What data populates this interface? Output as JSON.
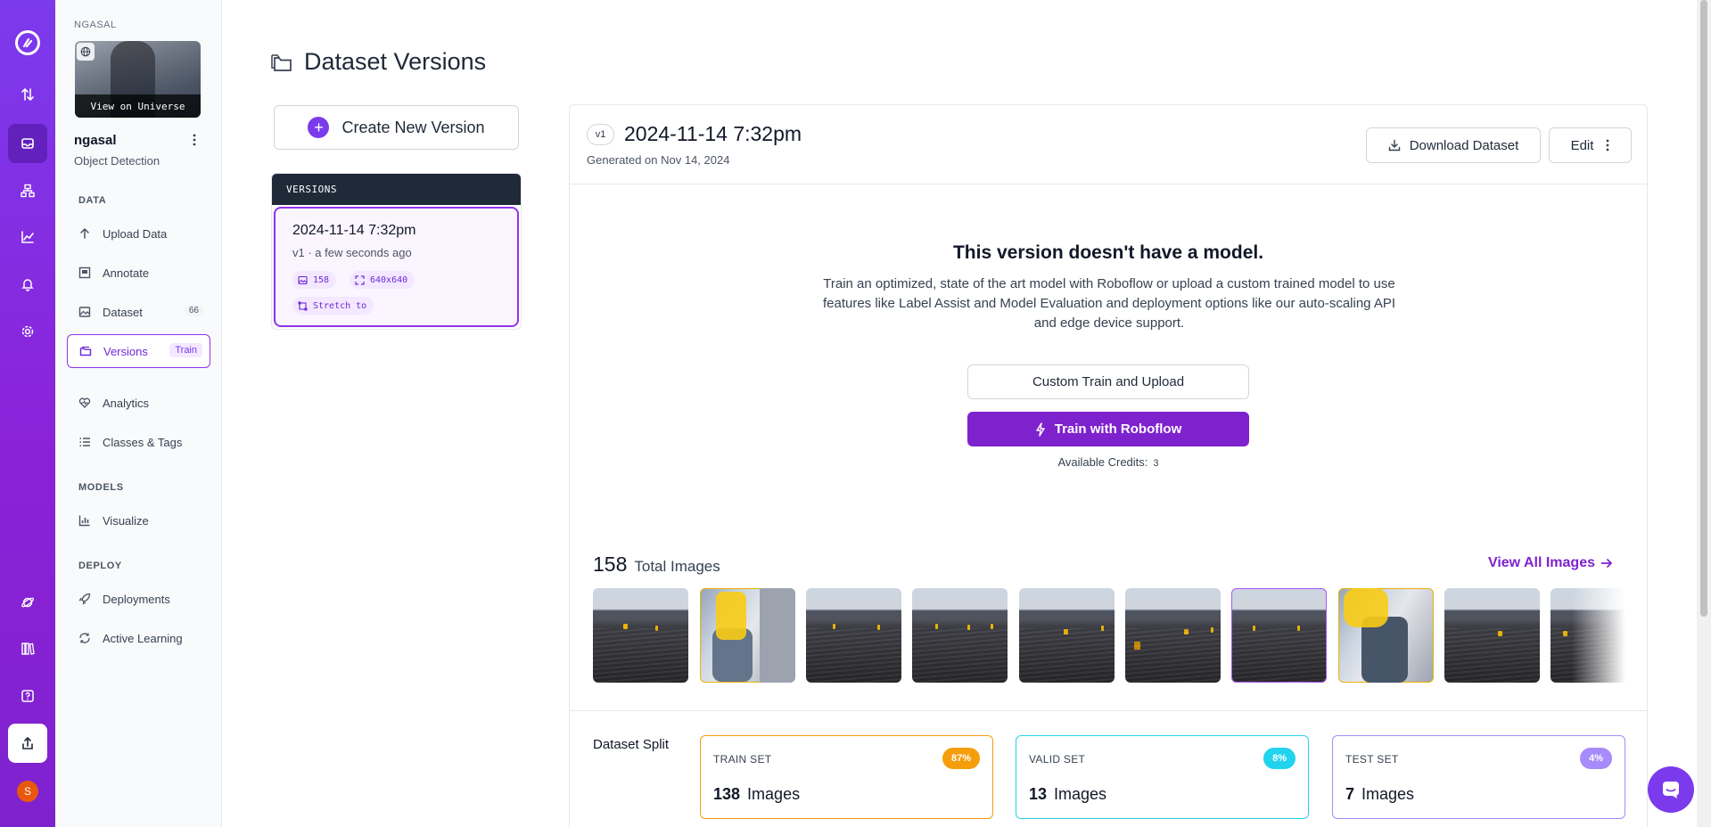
{
  "workspace": {
    "label": "NGASAL",
    "universe_button": "View on Universe"
  },
  "project": {
    "name": "ngasal",
    "type": "Object Detection"
  },
  "nav": {
    "data_heading": "DATA",
    "upload": "Upload Data",
    "annotate": "Annotate",
    "dataset": "Dataset",
    "dataset_count": "66",
    "versions": "Versions",
    "versions_badge": "Train",
    "analytics": "Analytics",
    "classes": "Classes & Tags",
    "models_heading": "MODELS",
    "visualize": "Visualize",
    "deploy_heading": "DEPLOY",
    "deployments": "Deployments",
    "active_learning": "Active Learning"
  },
  "user": {
    "initial": "S"
  },
  "page": {
    "title": "Dataset Versions"
  },
  "create_version": {
    "label": "Create New Version"
  },
  "versions_list": {
    "heading": "VERSIONS",
    "items": [
      {
        "title": "2024-11-14 7:32pm",
        "subtitle": "v1 · a few seconds ago",
        "images": "158",
        "size": "640x640",
        "resize": "Stretch to"
      }
    ]
  },
  "version_detail": {
    "badge": "v1",
    "title": "2024-11-14 7:32pm",
    "generated": "Generated on Nov 14, 2024",
    "download_label": "Download Dataset",
    "edit_label": "Edit",
    "no_model_title": "This version doesn't have a model.",
    "no_model_desc": "Train an optimized, state of the art model with Roboflow or upload a custom trained model to use features like Label Assist and Model Evaluation and deployment options like our auto-scaling API and edge device support.",
    "custom_train_label": "Custom Train and Upload",
    "train_label": "Train with Roboflow",
    "credits_label": "Available Credits:",
    "credits_value": "3",
    "total_images": "158",
    "total_label": "Total Images",
    "view_all_label": "View All Images",
    "split_label": "Dataset Split",
    "splits": [
      {
        "name": "TRAIN SET",
        "percent": "87%",
        "count": "138",
        "unit": "Images",
        "color": "#f59e0b"
      },
      {
        "name": "VALID SET",
        "percent": "8%",
        "count": "13",
        "unit": "Images",
        "color": "#22d3ee"
      },
      {
        "name": "TEST SET",
        "percent": "4%",
        "count": "7",
        "unit": "Images",
        "color": "#a78bfa"
      }
    ]
  },
  "colors": {
    "brand": "#7c3aed",
    "train_button": "#7e22ce",
    "active_border": "#9333ea"
  }
}
